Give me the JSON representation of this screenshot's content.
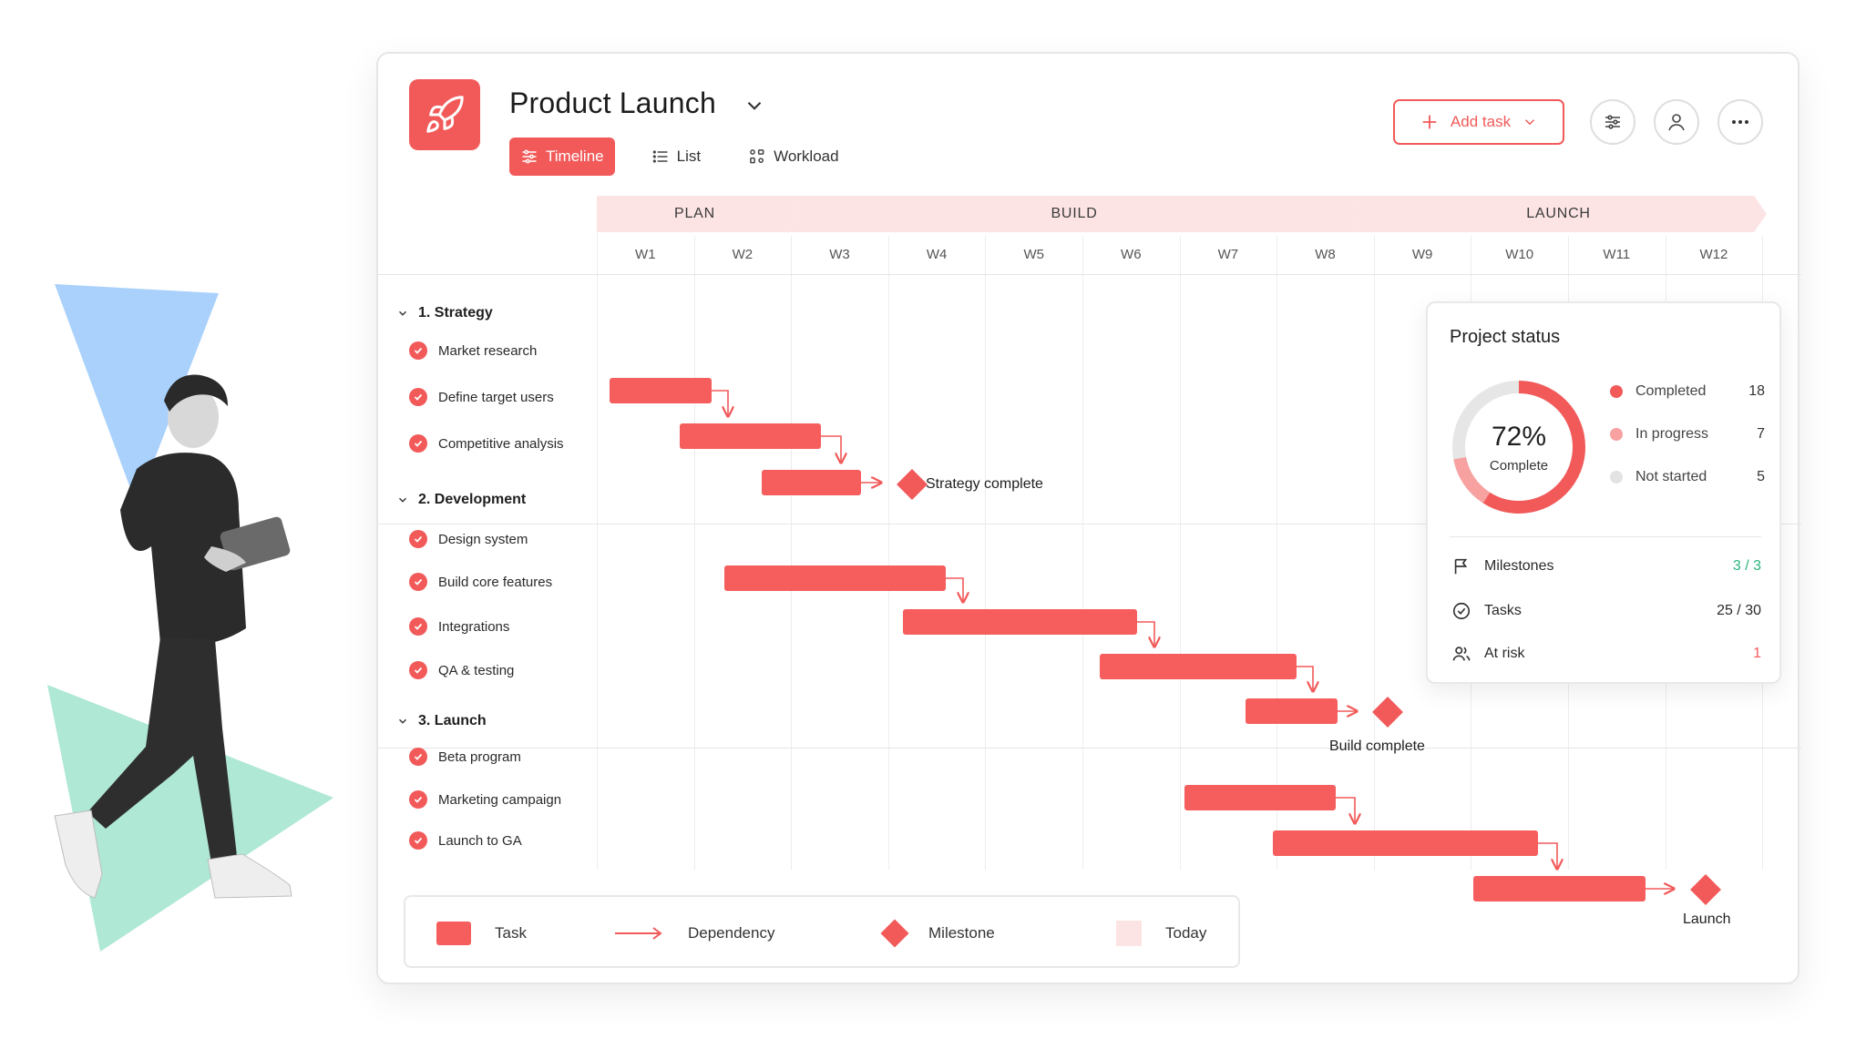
{
  "project": {
    "title": "Product Launch"
  },
  "tabs": [
    {
      "label": "Timeline",
      "active": true,
      "icon": "sliders-icon"
    },
    {
      "label": "List",
      "active": false,
      "icon": "list-icon"
    },
    {
      "label": "Workload",
      "active": false,
      "icon": "workload-icon"
    }
  ],
  "toolbar": {
    "add_task_label": "Add task"
  },
  "phases": [
    "PLAN",
    "BUILD",
    "LAUNCH"
  ],
  "weeks": [
    "W1",
    "W2",
    "W3",
    "W4",
    "W5",
    "W6",
    "W7",
    "W8",
    "W9",
    "W10",
    "W11",
    "W12"
  ],
  "groups": [
    {
      "label": "1. Strategy",
      "tasks": [
        "Market research",
        "Define target users",
        "Competitive analysis"
      ]
    },
    {
      "label": "2. Development",
      "tasks": [
        "Design system",
        "Build core features",
        "Integrations",
        "QA & testing"
      ]
    },
    {
      "label": "3. Launch",
      "tasks": [
        "Beta program",
        "Marketing campaign",
        "Launch to GA"
      ]
    }
  ],
  "milestones": [
    "Strategy complete",
    "Build complete",
    "Launch"
  ],
  "status": {
    "title": "Project status",
    "percent": "72%",
    "percent_sub": "Complete",
    "progress_fraction": 0.72,
    "legend": [
      {
        "label": "Completed",
        "value": "18",
        "color": "#f25a5a"
      },
      {
        "label": "In progress",
        "value": "7",
        "color": "#f7a1a1"
      },
      {
        "label": "Not started",
        "value": "5",
        "color": "#e3e3e3"
      }
    ],
    "stats": [
      {
        "label": "Milestones",
        "value": "3 / 3",
        "color": "#2ab57d",
        "icon": "flag-icon"
      },
      {
        "label": "Tasks",
        "value": "25 / 30",
        "color": "#1f1f1f",
        "icon": "check-circle-icon"
      },
      {
        "label": "At risk",
        "value": "1",
        "color": "#f25a5a",
        "icon": "users-icon"
      }
    ]
  },
  "legend_key": {
    "task": "Task",
    "dependency": "Dependency",
    "milestone": "Milestone",
    "today": "Today"
  },
  "colors": {
    "accent": "#f25a5a",
    "phase_bg": "#fde4e4",
    "success": "#2ab57d"
  }
}
